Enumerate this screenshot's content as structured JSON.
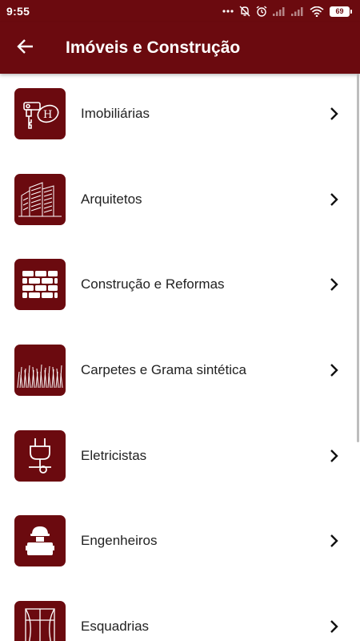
{
  "status_bar": {
    "time": "9:55",
    "battery": "69",
    "icons": [
      "more-dots-icon",
      "mute-icon",
      "alarm-icon",
      "signal-icon",
      "signal-icon",
      "wifi-icon",
      "battery-icon"
    ]
  },
  "app_bar": {
    "title": "Imóveis e Construção",
    "back_icon": "arrow-left-icon"
  },
  "colors": {
    "primary": "#6b0a0f",
    "text": "#222222",
    "background": "#ffffff"
  },
  "items": [
    {
      "label": "Imobiliárias",
      "icon": "keys-icon"
    },
    {
      "label": "Arquitetos",
      "icon": "buildings-icon"
    },
    {
      "label": "Construção e Reformas",
      "icon": "bricks-icon"
    },
    {
      "label": "Carpetes e Grama sintética",
      "icon": "grass-icon"
    },
    {
      "label": "Eletricistas",
      "icon": "plug-icon"
    },
    {
      "label": "Engenheiros",
      "icon": "engineer-icon"
    },
    {
      "label": "Esquadrias",
      "icon": "window-icon"
    }
  ]
}
